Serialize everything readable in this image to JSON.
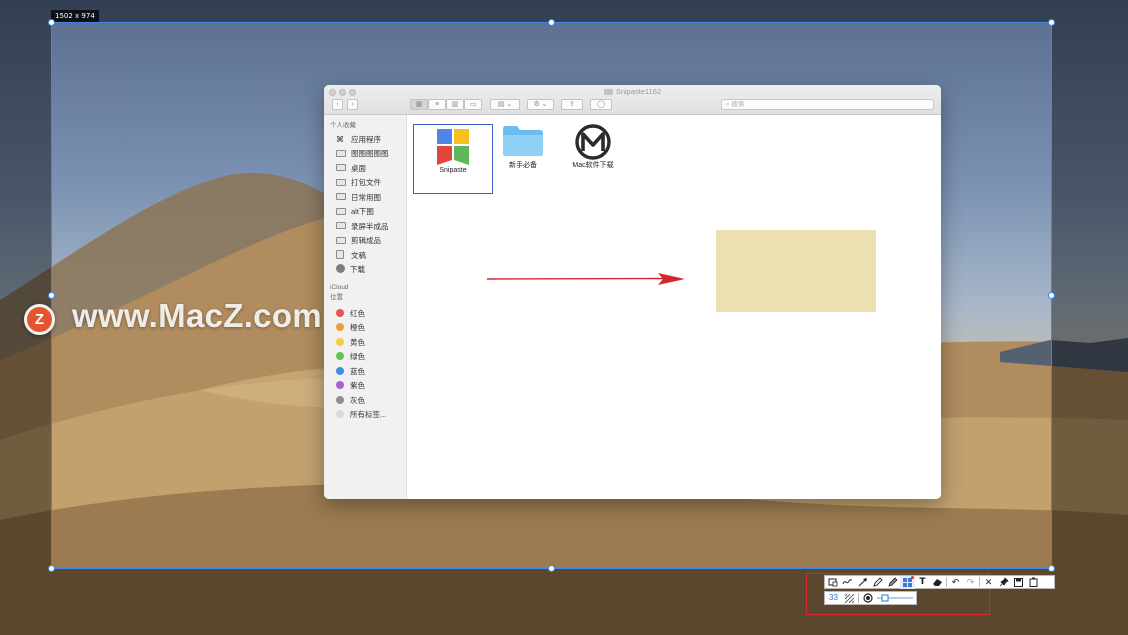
{
  "selection": {
    "size_label": "1502 x 974"
  },
  "finder": {
    "window_title": "Snipaste1162",
    "search_placeholder": "搜索",
    "sidebar": {
      "favorites_heading": "个人收藏",
      "favorites": [
        "应用程序",
        "图图图图图",
        "桌面",
        "打包文件",
        "日常用图",
        "alt下图",
        "录屏半成品",
        "剪辑成品",
        "文稿",
        "下载"
      ],
      "icloud_heading": "iCloud",
      "tags_heading": "位置",
      "tags": [
        {
          "label": "红色",
          "color": "#e8554d"
        },
        {
          "label": "橙色",
          "color": "#f0983a"
        },
        {
          "label": "黄色",
          "color": "#f3cd3d"
        },
        {
          "label": "绿色",
          "color": "#62c553"
        },
        {
          "label": "蓝色",
          "color": "#3f8de4"
        },
        {
          "label": "紫色",
          "color": "#a663cc"
        },
        {
          "label": "灰色",
          "color": "#8e8e93"
        },
        {
          "label": "所有标签...",
          "color": "#d9d9d9"
        }
      ]
    },
    "files": [
      {
        "name": "Snipaste",
        "icon": "snipaste-app-icon",
        "selected": true
      },
      {
        "name": "新手必备",
        "icon": "folder-icon",
        "selected": false
      },
      {
        "name": "Mac软件下载",
        "icon": "macz-logo-icon",
        "selected": false
      }
    ]
  },
  "watermark": {
    "badge": "Z",
    "text": "www.MacZ.com"
  },
  "toolbar": {
    "row1": [
      "rectangle-icon",
      "curve-icon",
      "arrow-icon",
      "pencil-icon",
      "marker-icon",
      "mosaic-icon",
      "text-icon",
      "eraser-icon",
      "undo-icon",
      "redo-icon",
      "close-icon",
      "pin-icon",
      "save-icon",
      "copy-icon"
    ],
    "row2": {
      "number_value": "33",
      "options": [
        "mosaic-pattern-icon",
        "blur-circle-icon",
        "size-slider"
      ]
    }
  },
  "colors": {
    "selection_border": "#3f86e6",
    "callout": "#e0242b",
    "arrow": "#d8262e",
    "mosaic": "#ede1b2"
  }
}
